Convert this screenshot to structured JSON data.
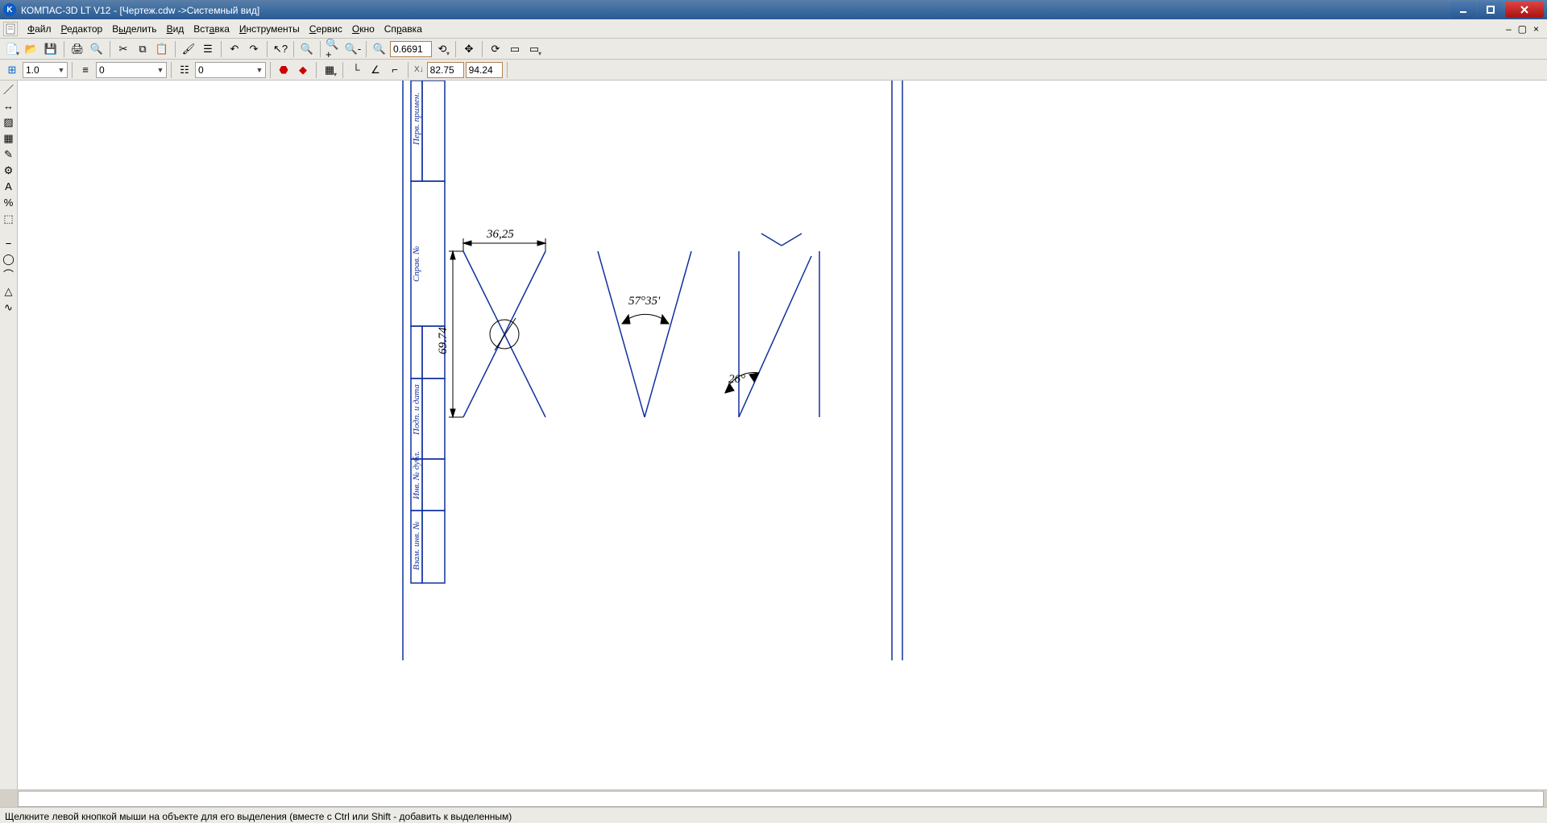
{
  "titlebar": {
    "app": "КОМПАС-3D LT V12",
    "doc": "[Чертеж.cdw ->Системный вид]"
  },
  "menu": {
    "file": "Файл",
    "edit": "Редактор",
    "select": "Выделить",
    "view": "Вид",
    "insert": "Вставка",
    "tools": "Инструменты",
    "service": "Сервис",
    "window": "Окно",
    "help": "Справка"
  },
  "tb1": {
    "zoom": "0.6691"
  },
  "tb2": {
    "step": "1.0",
    "style": "0",
    "layer": "0",
    "x": "82.75",
    "y": "94.24"
  },
  "drawing": {
    "dim_width": "36,25",
    "dim_height": "69.74",
    "angle_mid": "57°35'",
    "angle_right": "26°",
    "frame_labels": [
      "Перв. примен.",
      "Справ. №",
      "Подп. и дата",
      "Инв. № дубл.",
      "Взам. инв. №"
    ]
  },
  "status": {
    "hint": "Щелкните левой кнопкой мыши на объекте для его выделения (вместе с Ctrl или Shift - добавить к выделенным)"
  }
}
